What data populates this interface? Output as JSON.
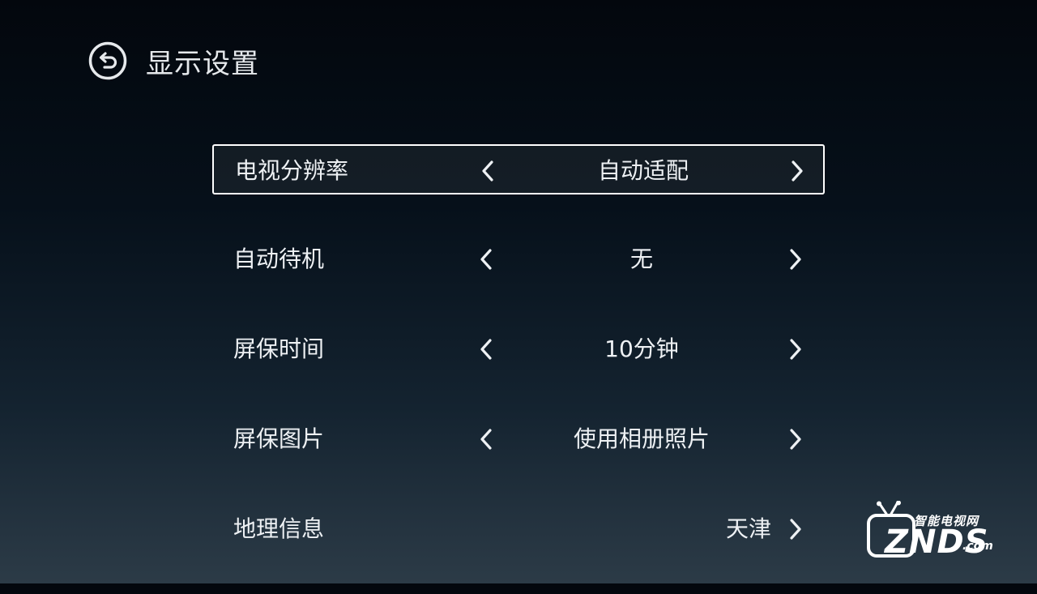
{
  "header": {
    "back_icon": "back-arrow-circle-icon",
    "title": "显示设置"
  },
  "settings": [
    {
      "label": "电视分辨率",
      "value": "自动适配",
      "focused": true
    },
    {
      "label": "自动待机",
      "value": "无"
    },
    {
      "label": "屏保时间",
      "value": "10分钟"
    },
    {
      "label": "屏保图片",
      "value": "使用相册照片"
    },
    {
      "label": "地理信息",
      "value": "天津"
    }
  ],
  "watermark": {
    "cn": "智能电视网",
    "en": "ZNDS",
    "suffix": ".com"
  },
  "colors": {
    "focus_border": "#ffffff",
    "text": "#eef1f4",
    "background_top": "#03070d",
    "background_bottom": "#2c3b47"
  }
}
